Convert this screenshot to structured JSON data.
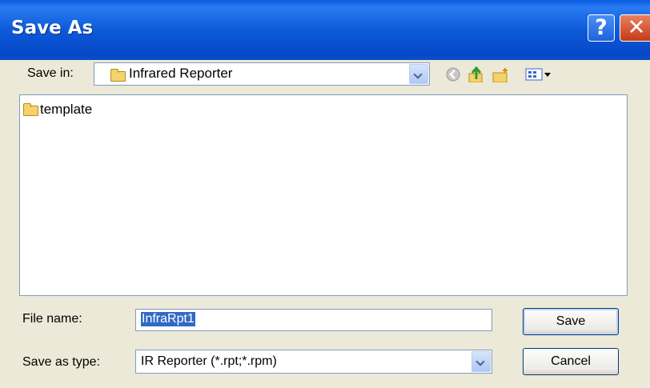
{
  "window": {
    "title": "Save As"
  },
  "titlebar": {
    "help_glyph": "?",
    "close_glyph": "✕"
  },
  "save_in": {
    "label": "Save in:",
    "value": "Infrared Reporter"
  },
  "toolbar": {
    "icons": [
      "back-icon",
      "up-folder-icon",
      "new-folder-icon",
      "view-menu-icon"
    ]
  },
  "file_list": {
    "items": [
      {
        "name": "template",
        "type": "folder"
      }
    ]
  },
  "file_name": {
    "label": "File name:",
    "value": "InfraRpt1"
  },
  "save_type": {
    "label": "Save as type:",
    "value": "IR Reporter (*.rpt;*.rpm)"
  },
  "buttons": {
    "save": "Save",
    "cancel": "Cancel"
  },
  "colors": {
    "titlebar": "#0a5ce0",
    "selection": "#316ac5",
    "dialog_bg": "#ece9d8"
  }
}
